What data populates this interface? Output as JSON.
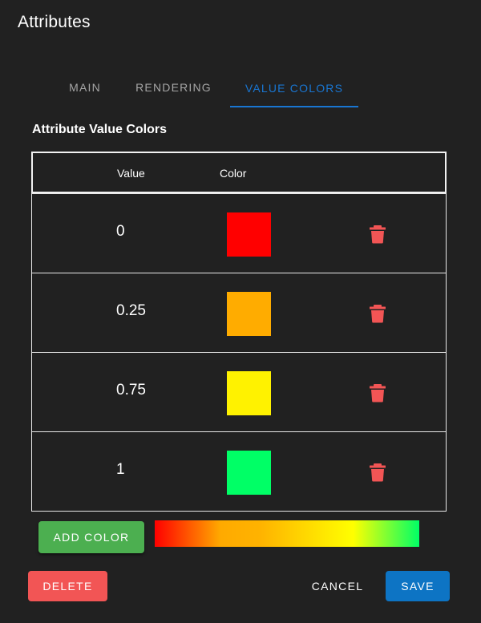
{
  "dialog": {
    "title": "Attributes"
  },
  "tabs": [
    {
      "label": "MAIN",
      "active": false
    },
    {
      "label": "RENDERING",
      "active": false
    },
    {
      "label": "VALUE COLORS",
      "active": true
    }
  ],
  "section": {
    "title": "Attribute Value Colors"
  },
  "table": {
    "headers": {
      "value": "Value",
      "color": "Color"
    },
    "rows": [
      {
        "value": "0",
        "color": "#ff0000"
      },
      {
        "value": "0.25",
        "color": "#ffac00"
      },
      {
        "value": "0.75",
        "color": "#fff200"
      },
      {
        "value": "1",
        "color": "#00ff66"
      }
    ],
    "delete_icon": "trash-icon",
    "delete_icon_color": "#f25555"
  },
  "actions": {
    "add_color": "ADD COLOR",
    "delete": "DELETE",
    "cancel": "CANCEL",
    "save": "SAVE"
  },
  "colors": {
    "background": "#212121",
    "accent": "#1976d2",
    "add_button": "#4caf50",
    "delete_button": "#f25555",
    "save_button": "#0d74c4"
  }
}
